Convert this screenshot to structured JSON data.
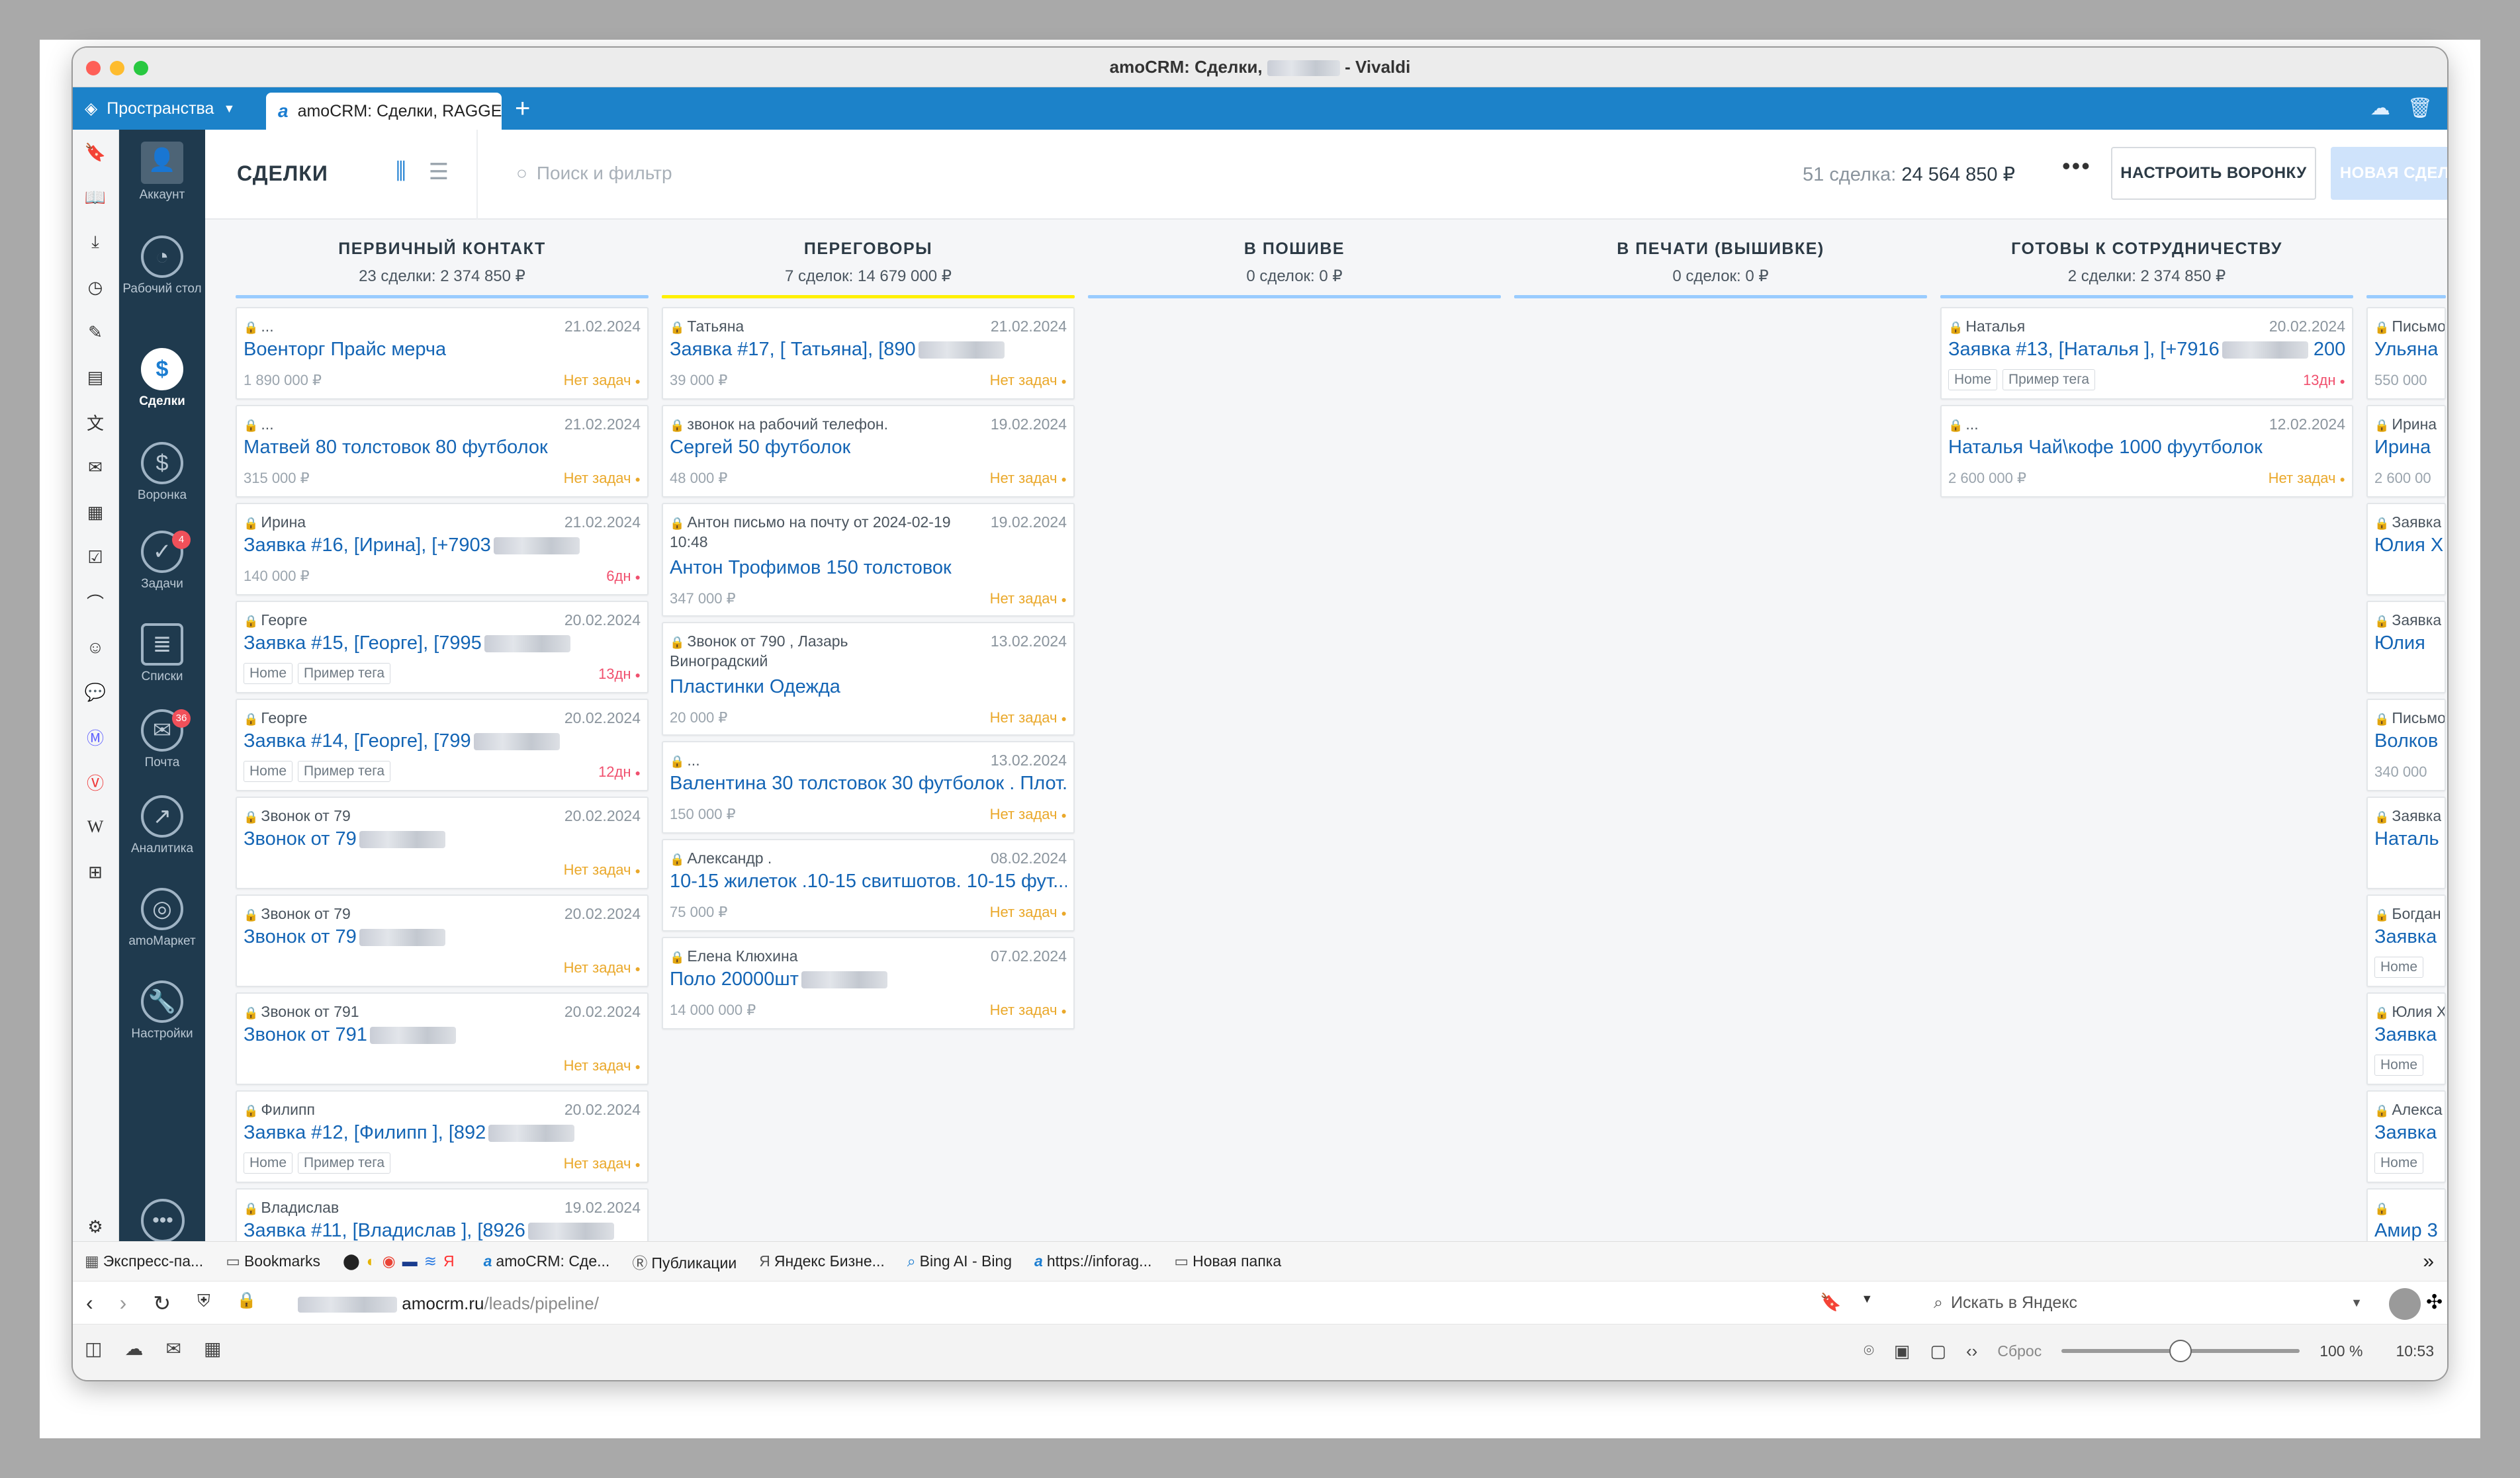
{
  "window": {
    "title_prefix": "amoCRM: Сделки,",
    "title_suffix": "- Vivaldi"
  },
  "tabs": {
    "spaces_label": "Пространства",
    "active_tab": "amoCRM: Сделки, RAGGE"
  },
  "left_nav": {
    "items": [
      {
        "label": "Аккаунт",
        "icon": "avatar-icon"
      },
      {
        "label": "Рабочий стол",
        "icon": "dashboard-icon"
      },
      {
        "label": "Сделки",
        "icon": "deals-icon"
      },
      {
        "label": "Воронка",
        "icon": "funnel-icon"
      },
      {
        "label": "Задачи",
        "icon": "tasks-icon",
        "badge": "4"
      },
      {
        "label": "Списки",
        "icon": "lists-icon"
      },
      {
        "label": "Почта",
        "icon": "mail-icon",
        "badge": "36"
      },
      {
        "label": "Аналитика",
        "icon": "analytics-icon"
      },
      {
        "label": "amoМаркет",
        "icon": "market-icon"
      },
      {
        "label": "Настройки",
        "icon": "settings-icon"
      }
    ]
  },
  "header": {
    "title": "СДЕЛКИ",
    "search_placeholder": "Поиск и фильтр",
    "summary_count": "51 сделка:",
    "summary_total": "24 564 850 ₽",
    "more_label": "•••",
    "setup_button": "НАСТРОИТЬ ВОРОНКУ",
    "new_button": "НОВАЯ СДЕЛКА"
  },
  "columns": [
    {
      "name": "ПЕРВИЧНЫЙ КОНТАКТ",
      "summary": "23 сделки: 2 374 850 ₽",
      "color": "#99ccff",
      "cards": [
        {
          "meta": "...",
          "date": "21.02.2024",
          "name": "Военторг Прайс мерча",
          "price": "1 890 000 ₽",
          "task": "Нет задач"
        },
        {
          "meta": "...",
          "date": "21.02.2024",
          "name": "Матвей 80 толстовок 80 футболок",
          "price": "315 000 ₽",
          "task": "Нет задач"
        },
        {
          "meta": "Ирина",
          "date": "21.02.2024",
          "name": "Заявка #16, [Ирина], [+7903",
          "price": "140 000 ₽",
          "task": "6дн",
          "overdue": true
        },
        {
          "meta": "Георге",
          "date": "20.02.2024",
          "name": "Заявка #15, [Георге], [7995",
          "tags": [
            "Home",
            "Пример тега"
          ],
          "task": "13дн",
          "overdue": true
        },
        {
          "meta": "Георге",
          "date": "20.02.2024",
          "name": "Заявка #14, [Георге], [799",
          "tags": [
            "Home",
            "Пример тега"
          ],
          "task": "12дн",
          "overdue": true
        },
        {
          "meta": "Звонок от 79",
          "date": "20.02.2024",
          "name": "Звонок от 79",
          "task": "Нет задач"
        },
        {
          "meta": "Звонок от 79",
          "date": "20.02.2024",
          "name": "Звонок от 79",
          "task": "Нет задач"
        },
        {
          "meta": "Звонок от 791",
          "date": "20.02.2024",
          "name": "Звонок от 791",
          "task": "Нет задач"
        },
        {
          "meta": "Филипп",
          "date": "20.02.2024",
          "name": "Заявка #12, [Филипп ], [892",
          "tags": [
            "Home",
            "Пример тега"
          ],
          "task": "Нет задач"
        },
        {
          "meta": "Владислав",
          "date": "19.02.2024",
          "name": "Заявка #11, [Владислав ], [8926",
          "task": ""
        }
      ]
    },
    {
      "name": "ПЕРЕГОВОРЫ",
      "summary": "7 сделок: 14 679 000 ₽",
      "color": "#fff000",
      "cards": [
        {
          "meta": "Татьяна",
          "date": "21.02.2024",
          "name": "Заявка #17, [ Татьяна], [890",
          "price": "39 000 ₽",
          "task": "Нет задач"
        },
        {
          "meta": "звонок на рабочий телефон.",
          "date": "19.02.2024",
          "name": "Сергей 50 футболок",
          "price": "48 000 ₽",
          "task": "Нет задач"
        },
        {
          "meta": "Антон письмо на почту от 2024-02-19",
          "meta2": "10:48",
          "date": "19.02.2024",
          "name": "Антон Трофимов 150 толстовок",
          "price": "347 000 ₽",
          "task": "Нет задач"
        },
        {
          "meta": "Звонок от 790       , Лазарь",
          "meta2": "Виноградский",
          "date": "13.02.2024",
          "name": "Пластинки Одежда",
          "price": "20 000 ₽",
          "task": "Нет задач"
        },
        {
          "meta": "...",
          "date": "13.02.2024",
          "name": "Валентина 30 толстовок 30 футболок . Плот...",
          "price": "150 000 ₽",
          "task": "Нет задач"
        },
        {
          "meta": "Александр .",
          "date": "08.02.2024",
          "name": "10-15 жилеток .10-15 свитшотов. 10-15 фут...",
          "price": "75 000 ₽",
          "task": "Нет задач"
        },
        {
          "meta": "Елена Клюхина",
          "date": "07.02.2024",
          "name": "Поло 20000шт",
          "price": "14 000 000 ₽",
          "task": "Нет задач"
        }
      ]
    },
    {
      "name": "В ПОШИВЕ",
      "summary": "0 сделок: 0 ₽",
      "color": "#99ccff",
      "cards": []
    },
    {
      "name": "В ПЕЧАТИ (ВЫШИВКЕ)",
      "summary": "0 сделок: 0 ₽",
      "color": "#99ccff",
      "cards": []
    },
    {
      "name": "ГОТОВЫ К СОТРУДНИЧЕСТВУ",
      "summary": "2 сделки: 2 374 850 ₽",
      "color": "#99ccff",
      "cards": [
        {
          "meta": "Наталья",
          "date": "20.02.2024",
          "name": "Заявка #13, [Наталья ], [+7916",
          "name_tail": "200...",
          "tags": [
            "Home",
            "Пример тега"
          ],
          "task": "13дн",
          "overdue": true
        },
        {
          "meta": "...",
          "date": "12.02.2024",
          "name": "Наталья Чай\\кофе 1000 фуутболок",
          "price": "2 600 000 ₽",
          "task": "Нет задач"
        }
      ]
    },
    {
      "name": "",
      "summary": "",
      "color": "#99ccff",
      "cards": [
        {
          "meta": "Письмо",
          "name": "Ульяна",
          "price": "550 000"
        },
        {
          "meta": "Ирина",
          "name": "Ирина",
          "price": "2 600 00"
        },
        {
          "meta": "Заявка",
          "name": "Юлия Х"
        },
        {
          "meta": "Заявка",
          "name": "Юлия"
        },
        {
          "meta": "Письмо",
          "name": "Волков",
          "price": "340 000"
        },
        {
          "meta": "Заявка",
          "name": "Наталь"
        },
        {
          "meta": "Богдан",
          "name": "Заявка",
          "tags": [
            "Home"
          ]
        },
        {
          "meta": "Юлия Х",
          "name": "Заявка",
          "tags": [
            "Home"
          ]
        },
        {
          "meta": "Алекса",
          "name": "Заявка",
          "tags": [
            "Home"
          ]
        },
        {
          "meta": "",
          "name": "Амир 3"
        }
      ]
    }
  ],
  "bookmarks": [
    "Экспресс-па...",
    "Bookmarks",
    "amoCRM: Сде...",
    "Публикации",
    "Яндекс Бизне...",
    "Bing AI - Bing",
    "https://inforag...",
    "Новая папка"
  ],
  "address": {
    "domain": "amocrm.ru",
    "path": "/leads/pipeline/",
    "search_placeholder": "Искать в Яндекс"
  },
  "status": {
    "reset_label": "Сброс",
    "zoom": "100 %",
    "zoom_fraction": 0.5,
    "time": "10:53"
  }
}
